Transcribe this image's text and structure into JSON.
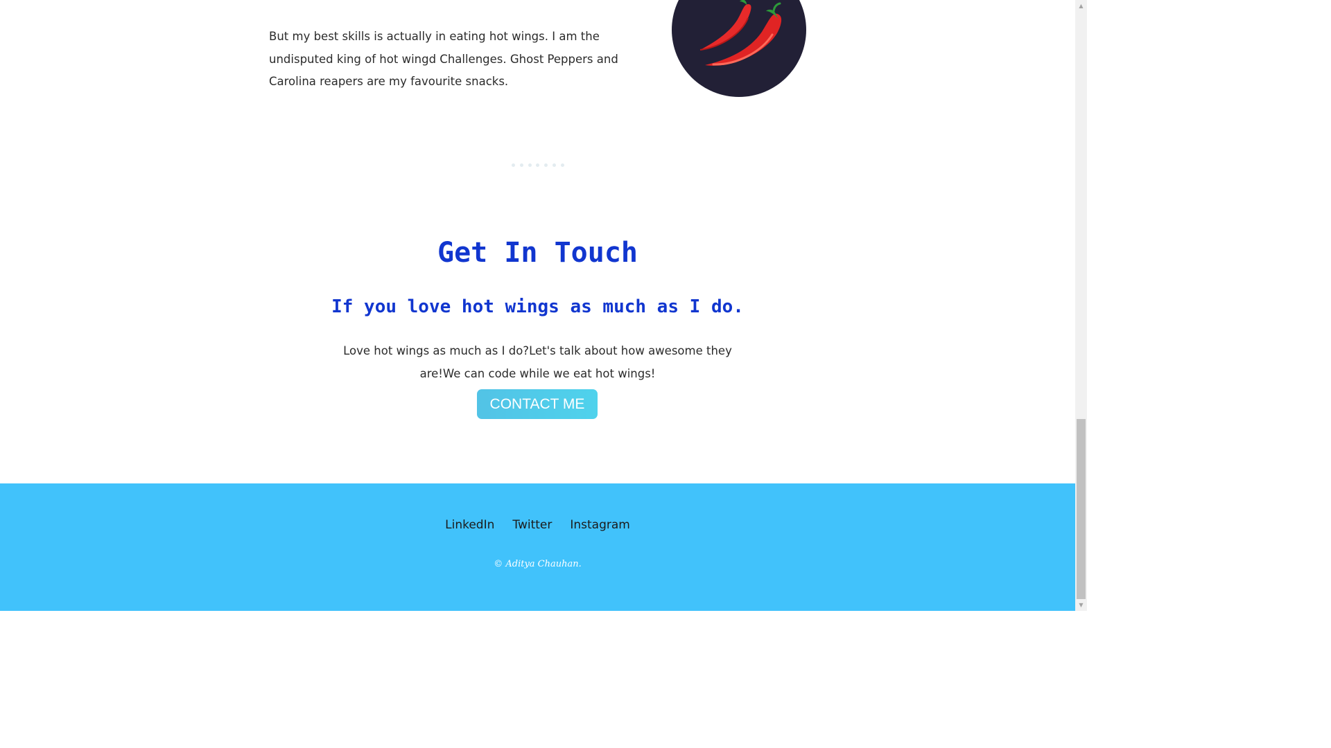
{
  "skills": {
    "paragraph": "But my best skills is actually in eating hot wings. I am the undisputed king of hot wingd Challenges. Ghost Peppers and Carolina reapers are my favourite snacks.",
    "image_icon": "chili-peppers-icon"
  },
  "contact": {
    "title": "Get In Touch",
    "subtitle": "If you love hot wings as much as I do.",
    "text": "Love hot wings as much as I do?Let's talk about how awesome they are!We can code while we eat hot wings!",
    "button_label": "CONTACT ME"
  },
  "footer": {
    "links": [
      "LinkedIn",
      "Twitter",
      "Instagram"
    ],
    "copyright": "© Aditya Chauhan."
  },
  "colors": {
    "heading": "#1136cf",
    "button": "#52c3e6",
    "footer_bg": "#41c2fb",
    "circle_bg": "#222036"
  }
}
